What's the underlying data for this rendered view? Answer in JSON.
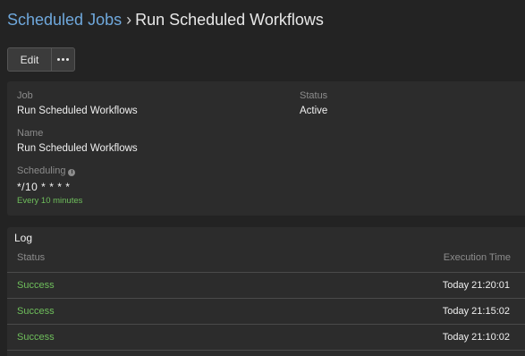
{
  "breadcrumb": {
    "parent": "Scheduled Jobs",
    "separator": "›",
    "current": "Run Scheduled Workflows"
  },
  "toolbar": {
    "edit_label": "Edit",
    "more_icon": "ellipsis-icon"
  },
  "details": {
    "job_label": "Job",
    "job_value": "Run Scheduled Workflows",
    "status_label": "Status",
    "status_value": "Active",
    "name_label": "Name",
    "name_value": "Run Scheduled Workflows",
    "scheduling_label": "Scheduling",
    "scheduling_icon": "info-icon",
    "cron_value": "*/10 * * * *",
    "cron_hint": "Every 10 minutes"
  },
  "log": {
    "title": "Log",
    "columns": [
      "Status",
      "Execution Time"
    ],
    "rows": [
      {
        "status": "Success",
        "time": "Today 21:20:01"
      },
      {
        "status": "Success",
        "time": "Today 21:15:02"
      },
      {
        "status": "Success",
        "time": "Today 21:10:02"
      }
    ]
  },
  "colors": {
    "link": "#6fa8dc",
    "success": "#6fbf5c",
    "background": "#232323",
    "panel": "#2c2c2c"
  }
}
